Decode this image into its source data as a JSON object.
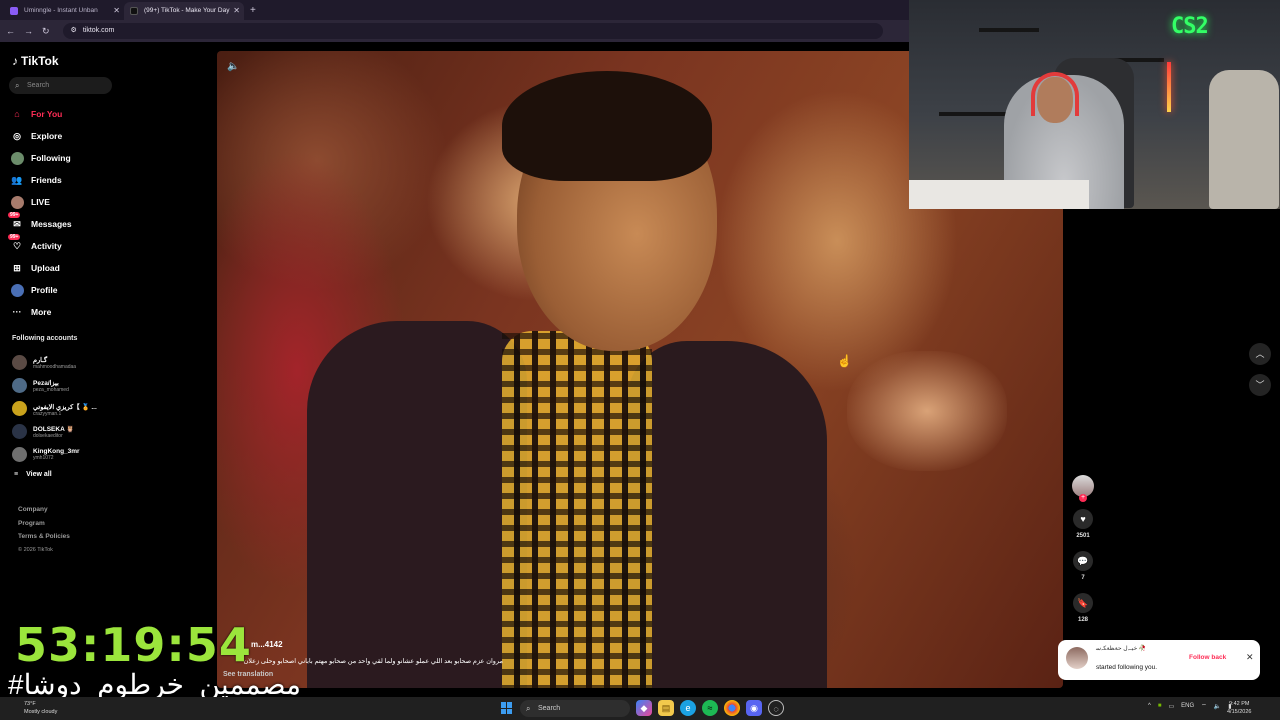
{
  "browser": {
    "tabs": [
      {
        "title": "Uminngle - Instant Unban",
        "active": false,
        "favicon_color": "#8a5cf6"
      },
      {
        "title": "(99+) TikTok - Make Your Day",
        "active": true,
        "favicon_color": "#111111"
      }
    ],
    "url": "tiktok.com"
  },
  "sidebar": {
    "logo": "TikTok",
    "search_placeholder": "Search",
    "nav": [
      {
        "label": "For You",
        "icon": "home-icon",
        "active": true
      },
      {
        "label": "Explore",
        "icon": "compass-icon",
        "active": false
      },
      {
        "label": "Following",
        "icon": "following-avatar-icon",
        "active": false
      },
      {
        "label": "Friends",
        "icon": "friends-icon",
        "active": false
      },
      {
        "label": "LIVE",
        "icon": "live-icon",
        "active": false
      },
      {
        "label": "Messages",
        "icon": "messages-icon",
        "badge": "99+",
        "active": false
      },
      {
        "label": "Activity",
        "icon": "activity-icon",
        "badge": "99+",
        "active": false
      },
      {
        "label": "Upload",
        "icon": "upload-icon",
        "active": false
      },
      {
        "label": "Profile",
        "icon": "profile-icon",
        "active": false
      },
      {
        "label": "More",
        "icon": "more-icon",
        "active": false
      }
    ],
    "following_title": "Following accounts",
    "accounts": [
      {
        "name": "گـارم",
        "username": "mahmoodhamadaa",
        "color": "#5a4a44"
      },
      {
        "name": "Peza/بيزا",
        "username": "peza_mohamed",
        "color": "#4e6a86"
      },
      {
        "name": "كريزي الايفوتي【 🏅 ...",
        "username": "crazyyman.1",
        "color": "#c9a21c"
      },
      {
        "name": "DOLSEKA 🦉",
        "username": "dolsekaeditor",
        "color": "#2a3346"
      },
      {
        "name": "KingKong_3mr",
        "username": "ymh1072",
        "color": "#6f6f6f"
      }
    ],
    "view_all": "View all",
    "footer": [
      "Company",
      "Program",
      "Terms & Policies"
    ],
    "copyright": "© 2026 TikTok"
  },
  "video": {
    "username": "m...4142",
    "caption": "مروان عزم صحابو بعد اللي عملو عشانو ولما لقي واحد من صحابو مهتم باباني اصحابو وحلى زعلان",
    "see_translation": "See translation",
    "likes": "2501",
    "comments": "7",
    "saves": "128"
  },
  "notification": {
    "name": "خيـﮧل ﺣﺔﻈﺔﻜﮧﺳ 🥀",
    "text": "started following you.",
    "action": "Follow back"
  },
  "overlay": {
    "timer": "53:19:54",
    "hashtag": "#مصممين_خرطوم_دوشا",
    "webcam_sign": "CS2"
  },
  "taskbar": {
    "weather_temp": "73°F",
    "weather_desc": "Mostly cloudy",
    "search": "Search",
    "lang": "ENG",
    "time": "9:42 PM",
    "date": "4/15/2026"
  },
  "colors": {
    "accent": "#fe2c55",
    "timer": "#9be53c"
  }
}
